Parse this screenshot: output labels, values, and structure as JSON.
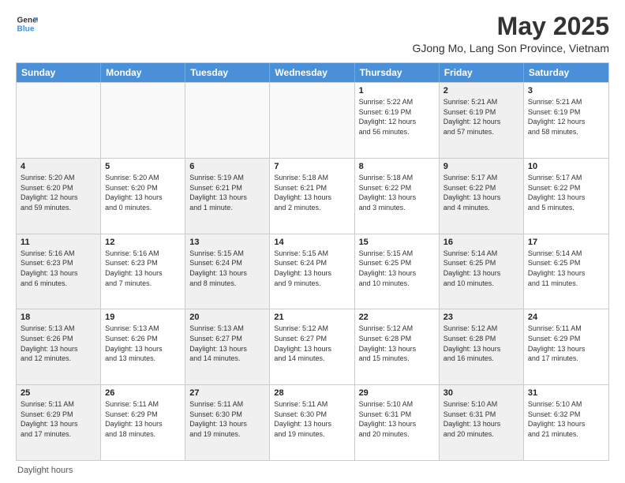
{
  "logo": {
    "line1": "General",
    "line2": "Blue"
  },
  "title": {
    "month_year": "May 2025",
    "location": "GJong Mo, Lang Son Province, Vietnam"
  },
  "days_of_week": [
    "Sunday",
    "Monday",
    "Tuesday",
    "Wednesday",
    "Thursday",
    "Friday",
    "Saturday"
  ],
  "weeks": [
    [
      {
        "day": "",
        "info": "",
        "shaded": false,
        "empty": true
      },
      {
        "day": "",
        "info": "",
        "shaded": false,
        "empty": true
      },
      {
        "day": "",
        "info": "",
        "shaded": false,
        "empty": true
      },
      {
        "day": "",
        "info": "",
        "shaded": false,
        "empty": true
      },
      {
        "day": "1",
        "info": "Sunrise: 5:22 AM\nSunset: 6:19 PM\nDaylight: 12 hours\nand 56 minutes.",
        "shaded": false,
        "empty": false
      },
      {
        "day": "2",
        "info": "Sunrise: 5:21 AM\nSunset: 6:19 PM\nDaylight: 12 hours\nand 57 minutes.",
        "shaded": true,
        "empty": false
      },
      {
        "day": "3",
        "info": "Sunrise: 5:21 AM\nSunset: 6:19 PM\nDaylight: 12 hours\nand 58 minutes.",
        "shaded": false,
        "empty": false
      }
    ],
    [
      {
        "day": "4",
        "info": "Sunrise: 5:20 AM\nSunset: 6:20 PM\nDaylight: 12 hours\nand 59 minutes.",
        "shaded": true,
        "empty": false
      },
      {
        "day": "5",
        "info": "Sunrise: 5:20 AM\nSunset: 6:20 PM\nDaylight: 13 hours\nand 0 minutes.",
        "shaded": false,
        "empty": false
      },
      {
        "day": "6",
        "info": "Sunrise: 5:19 AM\nSunset: 6:21 PM\nDaylight: 13 hours\nand 1 minute.",
        "shaded": true,
        "empty": false
      },
      {
        "day": "7",
        "info": "Sunrise: 5:18 AM\nSunset: 6:21 PM\nDaylight: 13 hours\nand 2 minutes.",
        "shaded": false,
        "empty": false
      },
      {
        "day": "8",
        "info": "Sunrise: 5:18 AM\nSunset: 6:22 PM\nDaylight: 13 hours\nand 3 minutes.",
        "shaded": false,
        "empty": false
      },
      {
        "day": "9",
        "info": "Sunrise: 5:17 AM\nSunset: 6:22 PM\nDaylight: 13 hours\nand 4 minutes.",
        "shaded": true,
        "empty": false
      },
      {
        "day": "10",
        "info": "Sunrise: 5:17 AM\nSunset: 6:22 PM\nDaylight: 13 hours\nand 5 minutes.",
        "shaded": false,
        "empty": false
      }
    ],
    [
      {
        "day": "11",
        "info": "Sunrise: 5:16 AM\nSunset: 6:23 PM\nDaylight: 13 hours\nand 6 minutes.",
        "shaded": true,
        "empty": false
      },
      {
        "day": "12",
        "info": "Sunrise: 5:16 AM\nSunset: 6:23 PM\nDaylight: 13 hours\nand 7 minutes.",
        "shaded": false,
        "empty": false
      },
      {
        "day": "13",
        "info": "Sunrise: 5:15 AM\nSunset: 6:24 PM\nDaylight: 13 hours\nand 8 minutes.",
        "shaded": true,
        "empty": false
      },
      {
        "day": "14",
        "info": "Sunrise: 5:15 AM\nSunset: 6:24 PM\nDaylight: 13 hours\nand 9 minutes.",
        "shaded": false,
        "empty": false
      },
      {
        "day": "15",
        "info": "Sunrise: 5:15 AM\nSunset: 6:25 PM\nDaylight: 13 hours\nand 10 minutes.",
        "shaded": false,
        "empty": false
      },
      {
        "day": "16",
        "info": "Sunrise: 5:14 AM\nSunset: 6:25 PM\nDaylight: 13 hours\nand 10 minutes.",
        "shaded": true,
        "empty": false
      },
      {
        "day": "17",
        "info": "Sunrise: 5:14 AM\nSunset: 6:25 PM\nDaylight: 13 hours\nand 11 minutes.",
        "shaded": false,
        "empty": false
      }
    ],
    [
      {
        "day": "18",
        "info": "Sunrise: 5:13 AM\nSunset: 6:26 PM\nDaylight: 13 hours\nand 12 minutes.",
        "shaded": true,
        "empty": false
      },
      {
        "day": "19",
        "info": "Sunrise: 5:13 AM\nSunset: 6:26 PM\nDaylight: 13 hours\nand 13 minutes.",
        "shaded": false,
        "empty": false
      },
      {
        "day": "20",
        "info": "Sunrise: 5:13 AM\nSunset: 6:27 PM\nDaylight: 13 hours\nand 14 minutes.",
        "shaded": true,
        "empty": false
      },
      {
        "day": "21",
        "info": "Sunrise: 5:12 AM\nSunset: 6:27 PM\nDaylight: 13 hours\nand 14 minutes.",
        "shaded": false,
        "empty": false
      },
      {
        "day": "22",
        "info": "Sunrise: 5:12 AM\nSunset: 6:28 PM\nDaylight: 13 hours\nand 15 minutes.",
        "shaded": false,
        "empty": false
      },
      {
        "day": "23",
        "info": "Sunrise: 5:12 AM\nSunset: 6:28 PM\nDaylight: 13 hours\nand 16 minutes.",
        "shaded": true,
        "empty": false
      },
      {
        "day": "24",
        "info": "Sunrise: 5:11 AM\nSunset: 6:29 PM\nDaylight: 13 hours\nand 17 minutes.",
        "shaded": false,
        "empty": false
      }
    ],
    [
      {
        "day": "25",
        "info": "Sunrise: 5:11 AM\nSunset: 6:29 PM\nDaylight: 13 hours\nand 17 minutes.",
        "shaded": true,
        "empty": false
      },
      {
        "day": "26",
        "info": "Sunrise: 5:11 AM\nSunset: 6:29 PM\nDaylight: 13 hours\nand 18 minutes.",
        "shaded": false,
        "empty": false
      },
      {
        "day": "27",
        "info": "Sunrise: 5:11 AM\nSunset: 6:30 PM\nDaylight: 13 hours\nand 19 minutes.",
        "shaded": true,
        "empty": false
      },
      {
        "day": "28",
        "info": "Sunrise: 5:11 AM\nSunset: 6:30 PM\nDaylight: 13 hours\nand 19 minutes.",
        "shaded": false,
        "empty": false
      },
      {
        "day": "29",
        "info": "Sunrise: 5:10 AM\nSunset: 6:31 PM\nDaylight: 13 hours\nand 20 minutes.",
        "shaded": false,
        "empty": false
      },
      {
        "day": "30",
        "info": "Sunrise: 5:10 AM\nSunset: 6:31 PM\nDaylight: 13 hours\nand 20 minutes.",
        "shaded": true,
        "empty": false
      },
      {
        "day": "31",
        "info": "Sunrise: 5:10 AM\nSunset: 6:32 PM\nDaylight: 13 hours\nand 21 minutes.",
        "shaded": false,
        "empty": false
      }
    ]
  ],
  "footer": {
    "daylight_label": "Daylight hours"
  }
}
